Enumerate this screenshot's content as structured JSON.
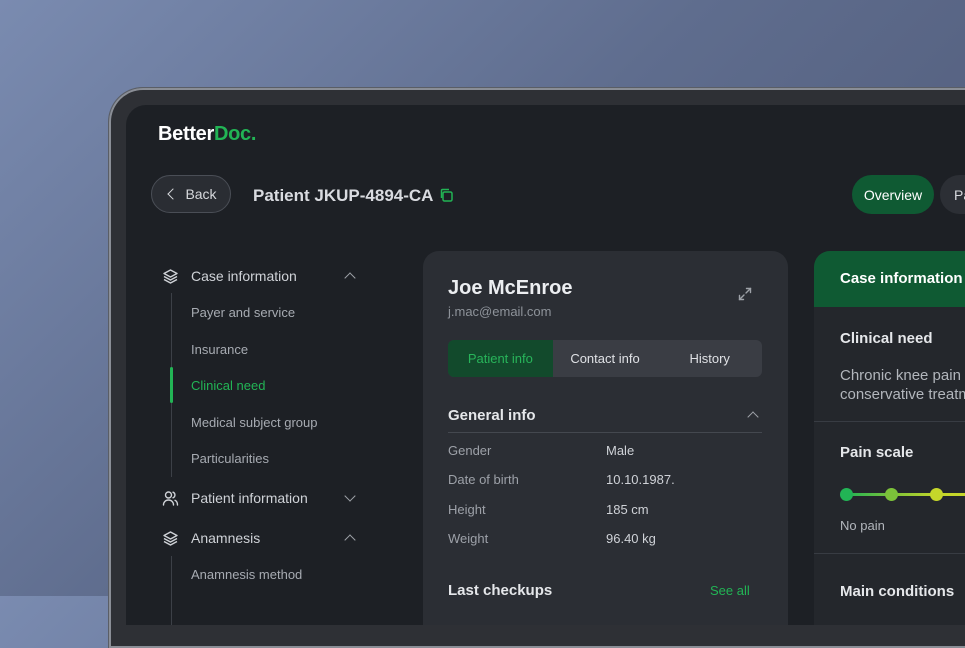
{
  "app": {
    "logo_part1": "Better",
    "logo_part2": "Doc.",
    "accent_color": "#22b455"
  },
  "header": {
    "back_label": "Back",
    "patient_id": "Patient JKUP-4894-CA",
    "copy_icon": "copy-icon",
    "nav_tabs": [
      {
        "label": "Overview",
        "active": true
      },
      {
        "label": "Pa",
        "active": false
      }
    ]
  },
  "sidebar": {
    "sections": [
      {
        "label": "Case information",
        "icon": "layers-icon",
        "expanded": true,
        "items": [
          {
            "label": "Payer and service",
            "active": false
          },
          {
            "label": "Insurance",
            "active": false
          },
          {
            "label": "Clinical need",
            "active": true
          },
          {
            "label": "Medical subject group",
            "active": false
          },
          {
            "label": "Particularities",
            "active": false
          }
        ]
      },
      {
        "label": "Patient information",
        "icon": "users-icon",
        "expanded": false,
        "items": []
      },
      {
        "label": "Anamnesis",
        "icon": "layers-icon",
        "expanded": true,
        "items": [
          {
            "label": "Anamnesis method",
            "active": false
          }
        ]
      }
    ]
  },
  "patient_card": {
    "name": "Joe McEnroe",
    "email": "j.mac@email.com",
    "tabs": [
      {
        "label": "Patient info",
        "active": true
      },
      {
        "label": "Contact info",
        "active": false
      },
      {
        "label": "History",
        "active": false
      }
    ],
    "general_info_title": "General info",
    "general_info": [
      {
        "label": "Gender",
        "value": "Male"
      },
      {
        "label": "Date of birth",
        "value": "10.10.1987."
      },
      {
        "label": "Height",
        "value": "185 cm"
      },
      {
        "label": "Weight",
        "value": "96.40 kg"
      }
    ],
    "checkups_title": "Last checkups",
    "see_all": "See all"
  },
  "case_panel": {
    "header": "Case information",
    "clinical_need_title": "Clinical need",
    "clinical_need_line1": "Chronic knee pain f",
    "clinical_need_line2": "conservative treatm",
    "pain_scale_title": "Pain scale",
    "pain_scale_low_label": "No pain",
    "pain_colors": [
      "#22b455",
      "#7cc23a",
      "#c5d62a"
    ],
    "main_conditions_title": "Main conditions"
  }
}
